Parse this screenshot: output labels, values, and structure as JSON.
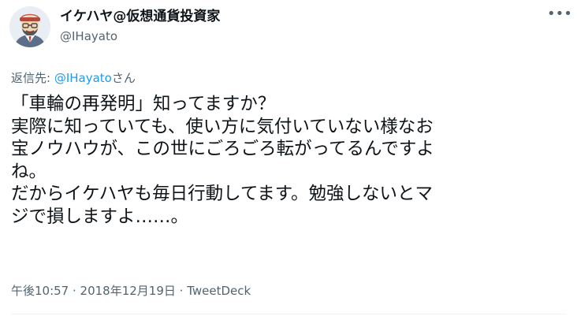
{
  "author": {
    "display_name": "イケハヤ@仮想通貨投資家",
    "handle": "@IHayato",
    "avatar_icon": "cartoon-man-avatar"
  },
  "more_icon": "ellipsis-icon",
  "reply": {
    "prefix": "返信先: ",
    "mention": "@IHayato",
    "suffix": "さん"
  },
  "body_lines": [
    "「車輪の再発明」知ってますか？",
    "実際に知っていても、使い方に気付いていない様なお",
    "宝ノウハウが、この世にごろごろ転がってるんですよ",
    "ね。",
    "だからイケハヤも毎日行動してます。勉強しないとマ",
    "ジで損しますよ……。"
  ],
  "meta": {
    "time": "午後10:57",
    "sep1": " · ",
    "date": "2018年12月19日",
    "sep2": " · ",
    "source": "TweetDeck"
  },
  "colors": {
    "text": "#0f1419",
    "secondary": "#536471",
    "link": "#1d9bf0"
  }
}
